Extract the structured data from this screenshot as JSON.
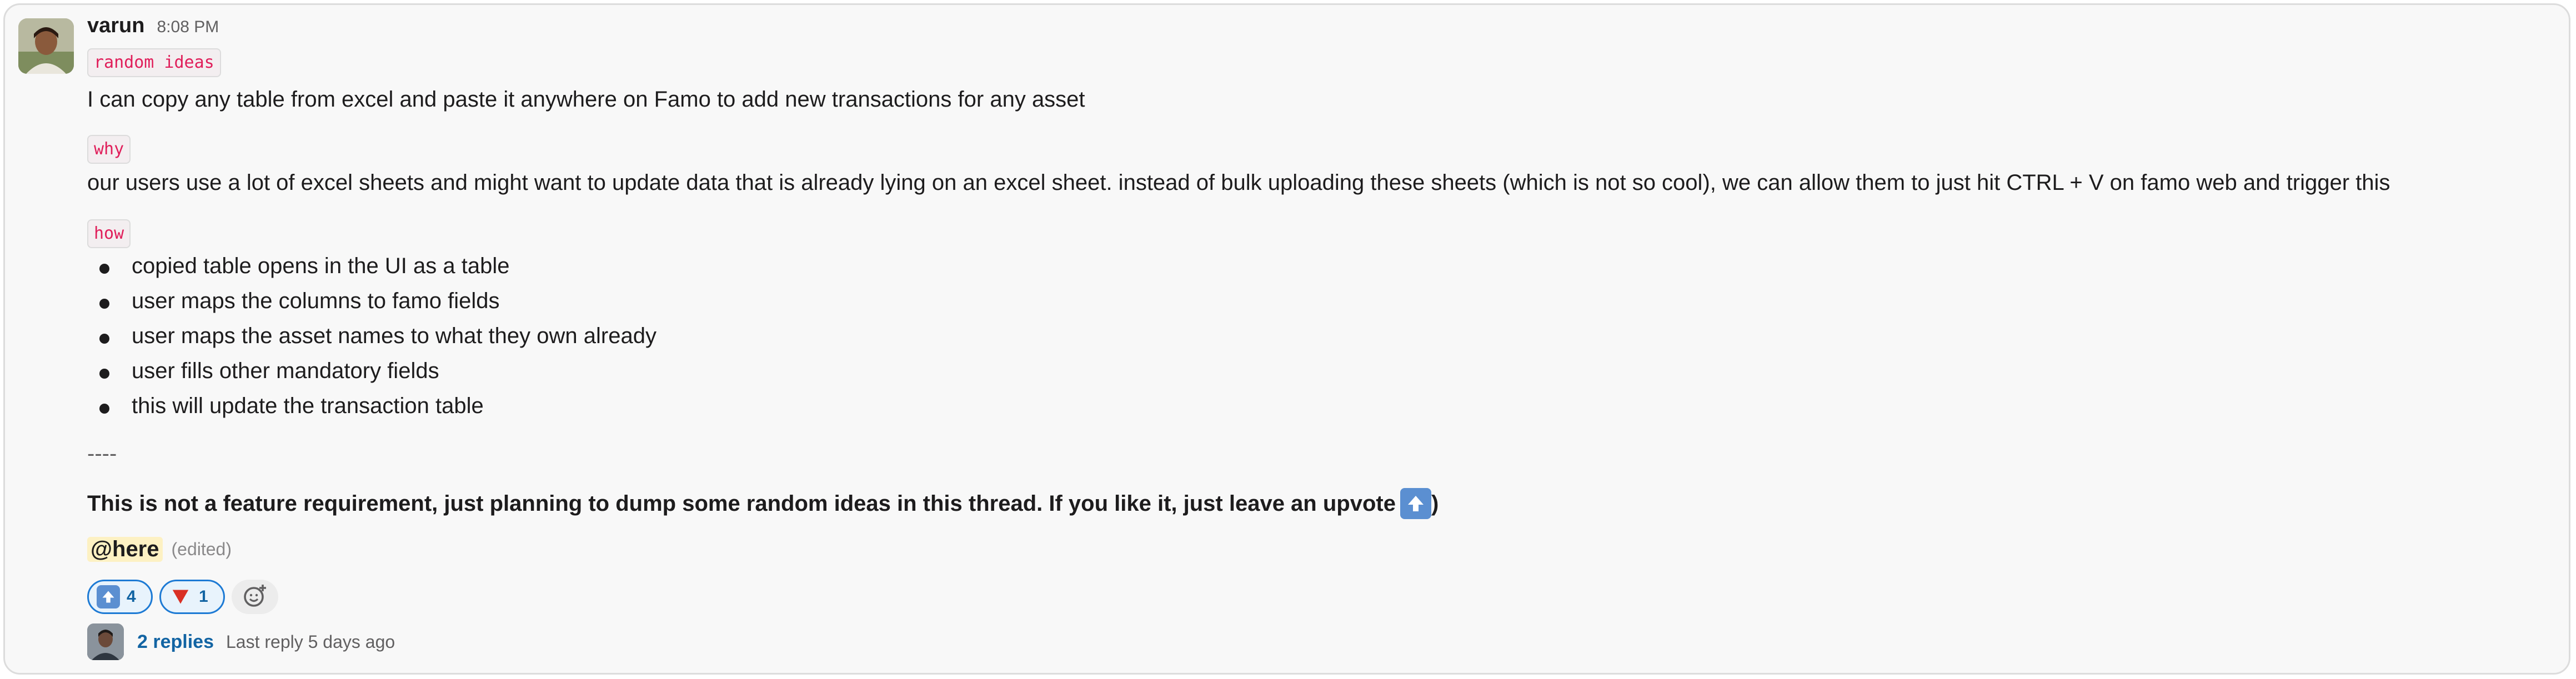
{
  "message": {
    "username": "varun",
    "timestamp": "8:08 PM",
    "tag_random": "random ideas",
    "line1": "I can copy any table from excel and paste it anywhere on Famo to add new transactions for any asset",
    "tag_why": "why",
    "why_text": "our users use a lot of excel sheets and might want to update data that is already lying on an excel sheet. instead of bulk uploading these sheets (which is not so cool), we can allow them to just hit CTRL + V on famo web and trigger this",
    "tag_how": "how",
    "bullets": [
      "copied table opens in the UI as a table",
      "user maps the columns to famo fields",
      "user maps the asset names to what they own already",
      "user fills other mandatory fields",
      "this will update the transaction table"
    ],
    "separator": "----",
    "bold_text": "This is not a feature requirement, just planning to dump some random ideas in this thread. If you like it, just leave an upvote ",
    "bold_close": ")",
    "mention": "@here",
    "edited": "(edited)"
  },
  "reactions": [
    {
      "emoji": "arrow-up-icon",
      "count": "4"
    },
    {
      "emoji": "red-triangle-down-icon",
      "count": "1"
    }
  ],
  "thread": {
    "replies": "2 replies",
    "last_reply": "Last reply 5 days ago"
  },
  "colors": {
    "code_text": "#e01e5a",
    "link": "#1264a3",
    "mention_bg": "#fdf1c3",
    "reaction_border": "#1d7ad4"
  }
}
